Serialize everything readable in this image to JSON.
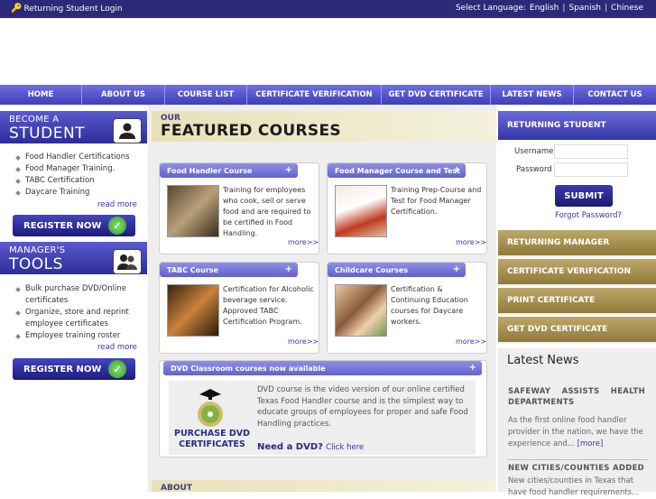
{
  "topbar": {
    "login": "Returning Student Login",
    "lang_label": "Select Language:",
    "languages": [
      "English",
      "Spanish",
      "Chinese"
    ],
    "sep": "|"
  },
  "nav": [
    "HOME",
    "ABOUT US",
    "COURSE LIST",
    "CERTIFICATE VERIFICATION",
    "GET DVD CERTIFICATE",
    "LATEST NEWS",
    "CONTACT US"
  ],
  "student": {
    "small": "BECOME A",
    "big": "STUDENT",
    "items": [
      "Food Handler Certifications",
      "Food Manager Training.",
      "TABC Certification",
      "Daycare Training"
    ],
    "read_more": "read more",
    "register": "REGISTER NOW"
  },
  "manager": {
    "small": "MANAGER'S",
    "big": "TOOLS",
    "items": [
      "Bulk purchase DVD/Online certificates",
      "Organize, store and reprint employee certificates",
      "Employee training roster"
    ],
    "read_more": "read more",
    "register": "REGISTER NOW"
  },
  "featured": {
    "our": "OUR",
    "title": "FEATURED COURSES",
    "plus": "+",
    "cards": [
      {
        "title": "Food Handler Course",
        "text": "Training for employees who cook, sell or serve food and are required to be certified in Food Handling.",
        "more": "more>>"
      },
      {
        "title": "Food Manager Course and Test",
        "text": "Training Prep-Course and Test for Food Manager Certification.",
        "more": "more>>"
      },
      {
        "title": "TABC Course",
        "text": "Certification for Alcoholic beverage service. Approved TABC Certification Program.",
        "more": "more>>"
      },
      {
        "title": "Childcare Courses",
        "text": "Certification & Continuing Education courses for Daycare workers.",
        "more": "more>>"
      }
    ],
    "dvd": {
      "title": "DVD Classroom courses now available",
      "purchase_line1": "PURCHASE DVD",
      "purchase_line2": "CERTIFICATES",
      "text": "DVD course is the video version of our online certified Texas Food Handler course and is the simplest way to educate groups of employees for proper and safe Food Handling practices.",
      "need": "Need a DVD?",
      "click": "Click here"
    },
    "about": "ABOUT"
  },
  "right": {
    "returning_student": "RETURNING STUDENT",
    "username_label": "Username",
    "password_label": "Password",
    "submit": "SUBMIT",
    "forgot": "Forgot Password?",
    "buttons": [
      "RETURNING MANAGER",
      "CERTIFICATE VERIFICATION",
      "PRINT CERTIFICATE",
      "GET DVD CERTIFICATE"
    ],
    "news_title": "Latest News",
    "news": [
      {
        "head": "SAFEWAY ASSISTS HEALTH DEPARTMENTS",
        "text": "As the first online food handler provider in the nation, we have the experience and...",
        "more": "[more]"
      },
      {
        "head": "NEW CITIES/COUNTIES ADDED",
        "text": "New cities/counties in Texas that have food handler requirements..."
      }
    ]
  }
}
